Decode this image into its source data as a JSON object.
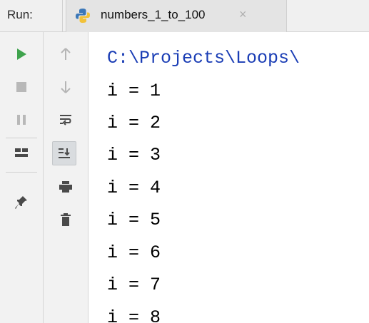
{
  "header": {
    "run_label": "Run:",
    "tab": {
      "label": "numbers_1_to_100",
      "close_glyph": "×",
      "icon": "python-file-icon"
    }
  },
  "toolbar": {
    "left": [
      {
        "name": "run-icon",
        "color": "#3fa34d"
      },
      {
        "name": "stop-icon",
        "color": "#b5b5b5"
      },
      {
        "name": "pause-icon",
        "color": "#b5b5b5"
      },
      {
        "name": "layout-icon",
        "color": "#4a4a4a"
      },
      {
        "name": "pin-icon",
        "color": "#4a4a4a"
      }
    ],
    "right": [
      {
        "name": "arrow-up-icon"
      },
      {
        "name": "arrow-down-icon"
      },
      {
        "name": "soft-wrap-icon"
      },
      {
        "name": "scroll-to-end-icon",
        "pressed": true
      },
      {
        "name": "print-icon"
      },
      {
        "name": "trash-icon"
      }
    ]
  },
  "console": {
    "path_line": "C:\\Projects\\Loops\\",
    "path_color": "#1a3db5",
    "lines": [
      "i = 1",
      "i = 2",
      "i = 3",
      "i = 4",
      "i = 5",
      "i = 6",
      "i = 7",
      "i = 8"
    ]
  }
}
